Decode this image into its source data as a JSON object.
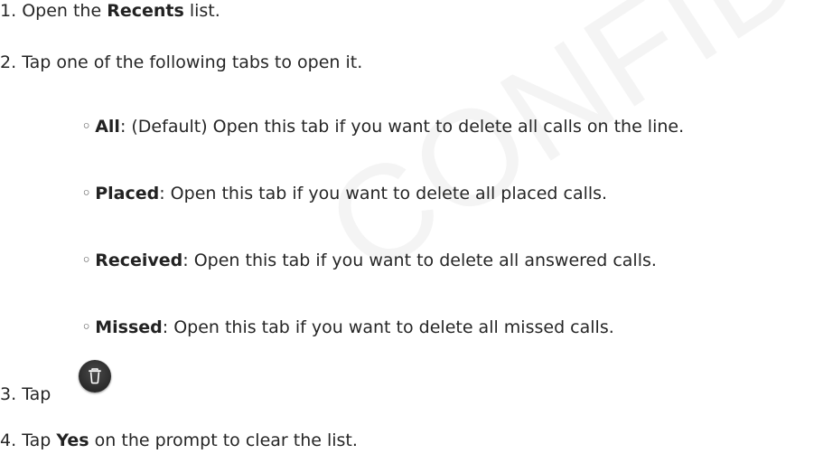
{
  "watermark": "CONFIDENTIAL DRAFT",
  "steps": {
    "s1": {
      "num": "1.",
      "pre": "Open the",
      "bold": "Recents",
      "post": "list."
    },
    "s2": {
      "num": "2.",
      "text": "Tap one of the following tabs to open it."
    },
    "s3": {
      "num": "3.",
      "pre": "Tap"
    },
    "s4": {
      "num": "4.",
      "pre": "Tap",
      "bold": "Yes",
      "post": "on the prompt to clear the list."
    }
  },
  "tabs": [
    {
      "bullet": "◦",
      "name": "All",
      "desc": ": (Default) Open this tab if you want to delete all calls on the line."
    },
    {
      "bullet": "◦",
      "name": "Placed",
      "desc": ": Open this tab if you want to delete all placed calls."
    },
    {
      "bullet": "◦",
      "name": "Received",
      "desc": ": Open this tab if you want to delete all answered calls."
    },
    {
      "bullet": "◦",
      "name": "Missed",
      "desc": ": Open this tab if you want to delete all missed calls."
    }
  ],
  "icons": {
    "delete_button": "trash-icon"
  },
  "colors": {
    "text": "#262626",
    "button_bg": "#2f2f2f",
    "icon": "#ffffff"
  }
}
